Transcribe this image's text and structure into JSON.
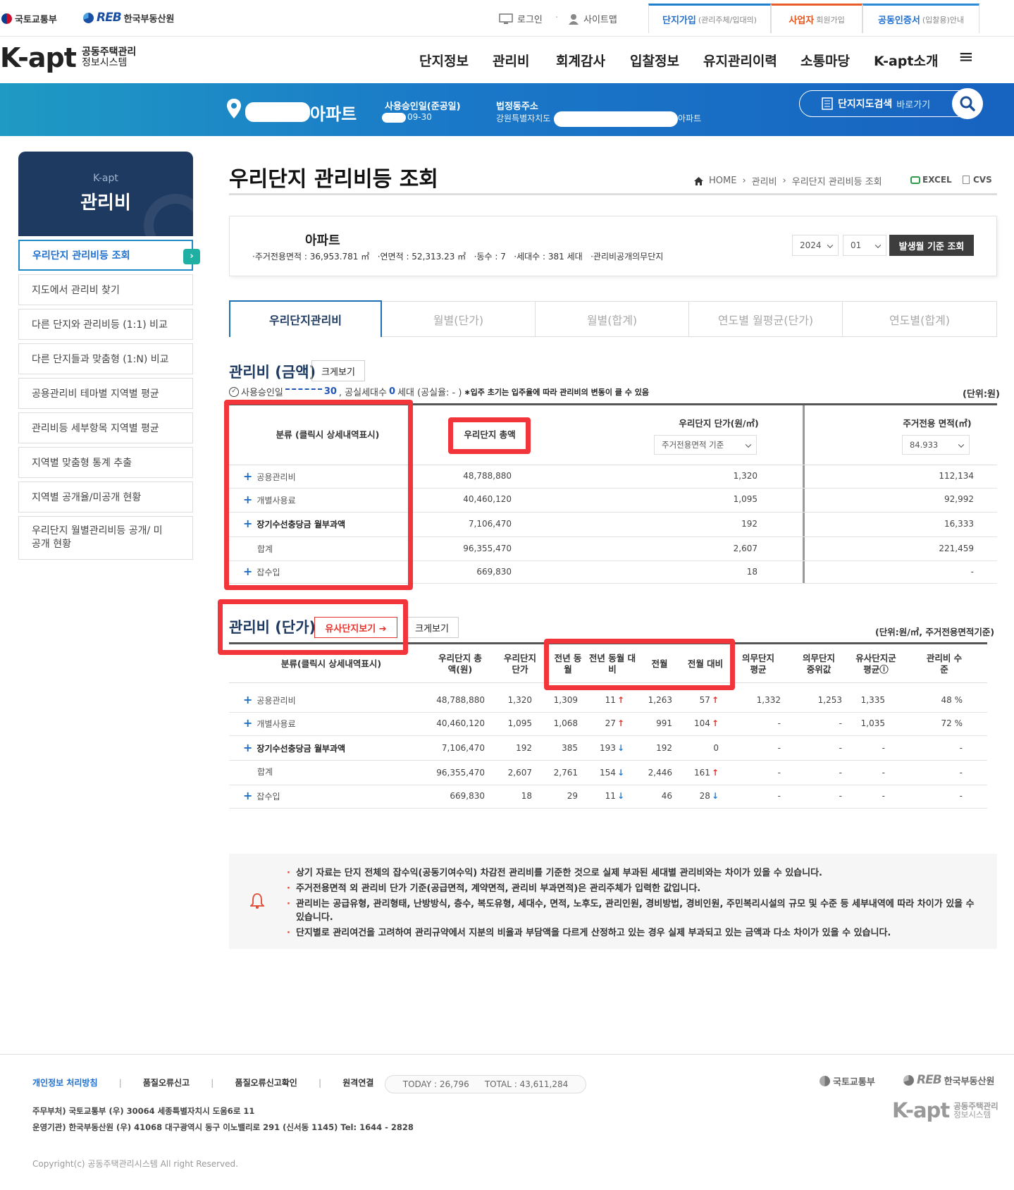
{
  "top": {
    "ministry": "국토교통부",
    "reb_mark": "REB",
    "reb_name": "한국부동산원",
    "login": "로그인",
    "sitemap": "사이트맵",
    "tabs": [
      {
        "label": "단지가입",
        "sub": "(관리주체/입대의)"
      },
      {
        "label": "사업자",
        "sub": "회원가입"
      },
      {
        "label": "공동인증서",
        "sub": "(입찰용)안내"
      }
    ]
  },
  "gnb": {
    "logo": "K-apt",
    "logo_sub1": "공동주택관리",
    "logo_sub2": "정보시스템",
    "menu": [
      "단지정보",
      "관리비",
      "회계감사",
      "입찰정보",
      "유지관리이력",
      "소통마당",
      "K-apt소개"
    ],
    "hamburger": "≡"
  },
  "band": {
    "apt_suffix": "아파트",
    "approval_label": "사용승인일(준공일)",
    "approval_value": "09-30",
    "addr_label": "법정동주소",
    "addr_value": "강원특별자치도",
    "addr_suffix": "아파트",
    "map_search": "단지지도검색",
    "map_search_sub": "바로가기"
  },
  "sidebar": {
    "kapt": "K-apt",
    "title": "관리비",
    "items": [
      "우리단지 관리비등 조회",
      "지도에서 관리비 찾기",
      "다른 단지와 관리비등 (1:1) 비교",
      "다른 단지들과 맞춤형 (1:N) 비교",
      "공용관리비 테마별 지역별 평균",
      "관리비등 세부항목 지역별 평균",
      "지역별 맞춤형 통계 추출",
      "지역별 공개율/미공개 현황",
      "우리단지 월별관리비등 공개/ 미공개 현황"
    ]
  },
  "page": {
    "title": "우리단지 관리비등 조회",
    "breadcrumb": [
      "HOME",
      "관리비",
      "우리단지 관리비등 조회"
    ],
    "excel": "EXCEL",
    "cvs": "CVS"
  },
  "summary": {
    "apt_name": "아파트",
    "stats": "·주거전용면적 : 36,953.781 ㎡   ·연면적 : 52,313.23 ㎡   ·동수 : 7   ·세대수 : 381 세대   ·관리비공개의무단지",
    "year": "2024",
    "month": "01",
    "query_btn": "발생월 기준 조회"
  },
  "tabs": [
    "우리단지관리비",
    "월별(단가)",
    "월별(합계)",
    "연도별 월평균(단가)",
    "연도별(합계)"
  ],
  "amount": {
    "title": "관리비 (금액)",
    "zoom": "크게보기",
    "info_pre": "사용승인일",
    "info_date": "30",
    "info_mid": ", 공실세대수",
    "info_zero": "0",
    "info_post": "세대 (공실율: - )",
    "note": "∗입주 초기는 입주율에 따라 관리비의 변동이 클 수 있음",
    "unit": "(단위:원)",
    "col_cat": "분류 (클릭시 상세내역표시)",
    "col_total": "우리단지 총액",
    "col_unit": "우리단지 단가(원/㎡)",
    "sel_basis": "주거전용면적 기준",
    "col_area": "주거전용 면적(㎡)",
    "sel_area": "84.933",
    "rows": [
      {
        "name": "공용관리비",
        "plus": "+",
        "total": "48,788,880",
        "unit": "1,320",
        "area": "112,134"
      },
      {
        "name": "개별사용료",
        "plus": "+",
        "total": "40,460,120",
        "unit": "1,095",
        "area": "92,992"
      },
      {
        "name": "장기수선충당금 월부과액",
        "plus": "+",
        "total": "7,106,470",
        "unit": "192",
        "area": "16,333"
      },
      {
        "name": "합계",
        "plus": "",
        "total": "96,355,470",
        "unit": "2,607",
        "area": "221,459"
      },
      {
        "name": "잡수입",
        "plus": "+",
        "total": "669,830",
        "unit": "18",
        "area": "-"
      }
    ]
  },
  "unit_price": {
    "title": "관리비 (단가)",
    "similar_btn": "유사단지보기 ➔",
    "zoom": "크게보기",
    "unit": "(단위:원/㎡, 주거전용면적기준)",
    "headers": [
      "분류(클릭시 상세내역표시)",
      "우리단지 총액(원)",
      "우리단지 단가",
      "전년 동월",
      "전년 동월 대비",
      "전월",
      "전월 대비",
      "의무단지 평균",
      "의무단지 중위값",
      "유사단지군 평균ⓘ",
      "관리비 수준"
    ],
    "rows": [
      {
        "name": "공용관리비",
        "plus": "+",
        "total": "48,788,880",
        "price": "1,320",
        "py": "1,309",
        "pyd": "11",
        "pyd_dir": "↑",
        "pm": "1,263",
        "pmd": "57",
        "pmd_dir": "↑",
        "avg": "1,332",
        "med": "1,253",
        "sim": "1,335",
        "level": "48 %"
      },
      {
        "name": "개별사용료",
        "plus": "+",
        "total": "40,460,120",
        "price": "1,095",
        "py": "1,068",
        "pyd": "27",
        "pyd_dir": "↑",
        "pm": "991",
        "pmd": "104",
        "pmd_dir": "↑",
        "avg": "-",
        "med": "-",
        "sim": "1,035",
        "level": "72 %"
      },
      {
        "name": "장기수선충당금 월부과액",
        "plus": "+",
        "total": "7,106,470",
        "price": "192",
        "py": "385",
        "pyd": "193",
        "pyd_dir": "↓",
        "pm": "192",
        "pmd": "0",
        "pmd_dir": "",
        "avg": "-",
        "med": "-",
        "sim": "-",
        "level": "-"
      },
      {
        "name": "합계",
        "plus": "",
        "total": "96,355,470",
        "price": "2,607",
        "py": "2,761",
        "pyd": "154",
        "pyd_dir": "↓",
        "pm": "2,446",
        "pmd": "161",
        "pmd_dir": "↑",
        "avg": "-",
        "med": "-",
        "sim": "-",
        "level": "-"
      },
      {
        "name": "잡수입",
        "plus": "+",
        "total": "669,830",
        "price": "18",
        "py": "29",
        "pyd": "11",
        "pyd_dir": "↓",
        "pm": "46",
        "pmd": "28",
        "pmd_dir": "↓",
        "avg": "-",
        "med": "-",
        "sim": "-",
        "level": "-"
      }
    ]
  },
  "notice": [
    "상기 자료는 단지 전체의 잡수익(공동기여수익) 차감전 관리비를 기준한 것으로 실제 부과된 세대별 관리비와는 차이가 있을 수 있습니다.",
    "주거전용면적 외 관리비 단가 기준(공급면적, 계약면적, 관리비 부과면적)은 관리주체가 입력한 값입니다.",
    "관리비는 공급유형, 관리형태, 난방방식, 층수, 복도유형, 세대수, 면적, 노후도, 관리인원, 경비방법, 경비인원, 주민복리시설의 규모 및 수준 등 세부내역에 따라 차이가 있을 수 있습니다.",
    "단지별로 관리여건을 고려하여 관리규약에서 지분의 비율과 부담액을 다르게 산정하고 있는 경우 실제 부과되고 있는 금액과 다소 차이가 있을 수 있습니다."
  ],
  "footer": {
    "links": [
      "개인정보 처리방침",
      "품질오류신고",
      "품질오류신고확인",
      "원격연결"
    ],
    "today": "TODAY : 26,796",
    "total": "TOTAL : 43,611,284",
    "addr1": "주무부처) 국토교통부 (우) 30064 세종특별자치시 도움6로 11",
    "addr2": "운영기관) 한국부동산원 (우) 41068 대구광역시 동구 이노밸리로 291 (신서동 1145) Tel: 1644 - 2828",
    "copyright": "Copyright(c) 공동주택관리시스템 All right Reserved.",
    "ministry": "국토교통부",
    "reb_mark": "REB",
    "reb_name": "한국부동산원",
    "logo": "K-apt",
    "logo_sub1": "공동주택관리",
    "logo_sub2": "정보시스템"
  }
}
